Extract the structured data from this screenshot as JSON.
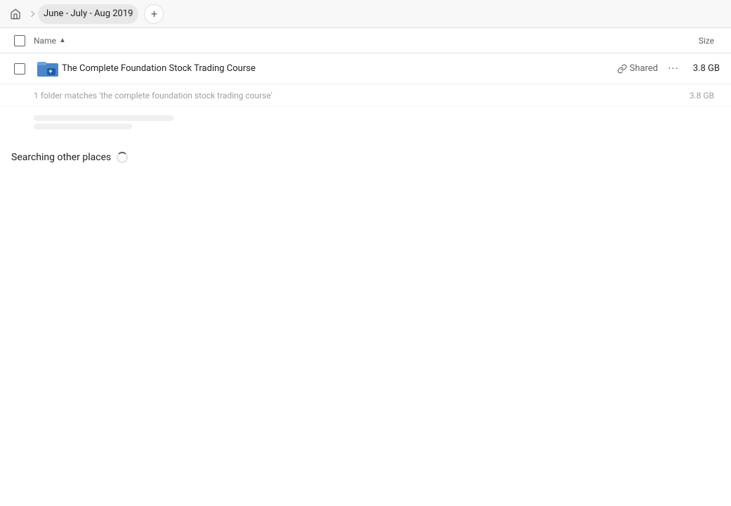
{
  "topbar": {
    "home_label": "Home",
    "breadcrumb": "June - July - Aug 2019",
    "add_label": "+"
  },
  "columns": {
    "name_label": "Name",
    "sort_indicator": "▲",
    "size_label": "Size"
  },
  "results": {
    "file": {
      "name": "The Complete Foundation Stock Trading Course",
      "shared_label": "Shared",
      "size": "3.8 GB"
    },
    "sub_info": "1 folder matches 'the complete foundation stock trading course'",
    "sub_size": "3.8 GB"
  },
  "searching": {
    "label": "Searching other places"
  },
  "icons": {
    "home": "⌂",
    "link": "🔗",
    "more": "···"
  }
}
